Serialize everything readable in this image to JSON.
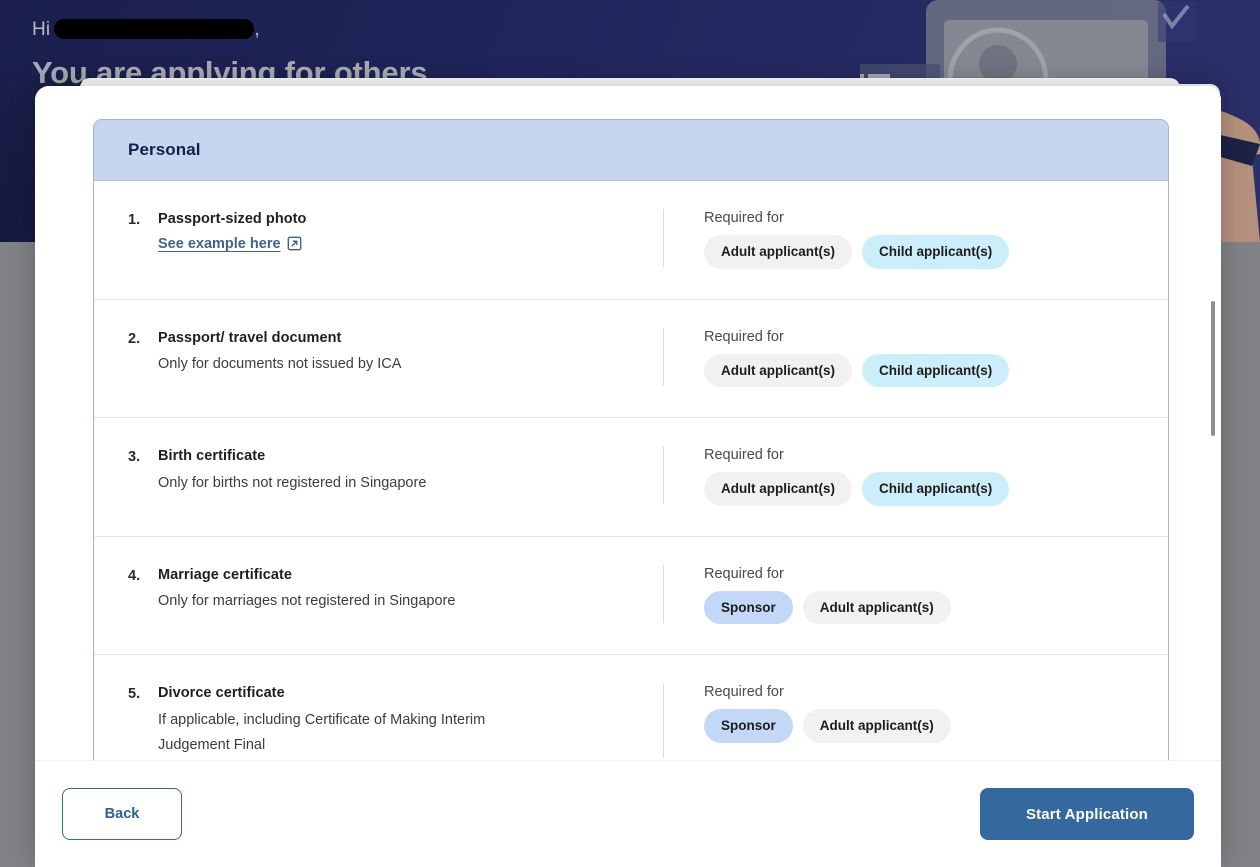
{
  "background": {
    "greeting_prefix": "Hi",
    "greeting_suffix": ",",
    "title": "You are applying for others."
  },
  "modal": {
    "card": {
      "section_title": "Personal",
      "required_for_label": "Required for",
      "rows": [
        {
          "index": "1.",
          "title": "Passport-sized photo",
          "subtitle": "",
          "link_label": "See example here",
          "badges": [
            {
              "label": "Adult applicant(s)",
              "style": "adult"
            },
            {
              "label": "Child applicant(s)",
              "style": "child"
            }
          ]
        },
        {
          "index": "2.",
          "title": "Passport/ travel document",
          "subtitle": "Only for documents not issued by ICA",
          "link_label": "",
          "badges": [
            {
              "label": "Adult applicant(s)",
              "style": "adult"
            },
            {
              "label": "Child applicant(s)",
              "style": "child"
            }
          ]
        },
        {
          "index": "3.",
          "title": "Birth certificate",
          "subtitle": "Only for births not registered in Singapore",
          "link_label": "",
          "badges": [
            {
              "label": "Adult applicant(s)",
              "style": "adult"
            },
            {
              "label": "Child applicant(s)",
              "style": "child"
            }
          ]
        },
        {
          "index": "4.",
          "title": "Marriage certificate",
          "subtitle": "Only for marriages not registered in Singapore",
          "link_label": "",
          "badges": [
            {
              "label": "Sponsor",
              "style": "sponsor"
            },
            {
              "label": "Adult applicant(s)",
              "style": "adult"
            }
          ]
        },
        {
          "index": "5.",
          "title": "Divorce certificate",
          "subtitle": "If applicable, including Certificate of Making Interim Judgement Final",
          "link_label": "",
          "badges": [
            {
              "label": "Sponsor",
              "style": "sponsor"
            },
            {
              "label": "Adult applicant(s)",
              "style": "adult"
            }
          ]
        }
      ]
    },
    "footer": {
      "back_label": "Back",
      "start_label": "Start Application"
    }
  },
  "colors": {
    "banner_navy": "#20265c",
    "section_header_blue": "#c7d5ef",
    "primary_button_blue": "#35689e",
    "badge_sponsor": "#c3d7f7",
    "badge_adult": "#f1f1f1",
    "badge_child": "#cceefb",
    "link_blue": "#41638f"
  }
}
